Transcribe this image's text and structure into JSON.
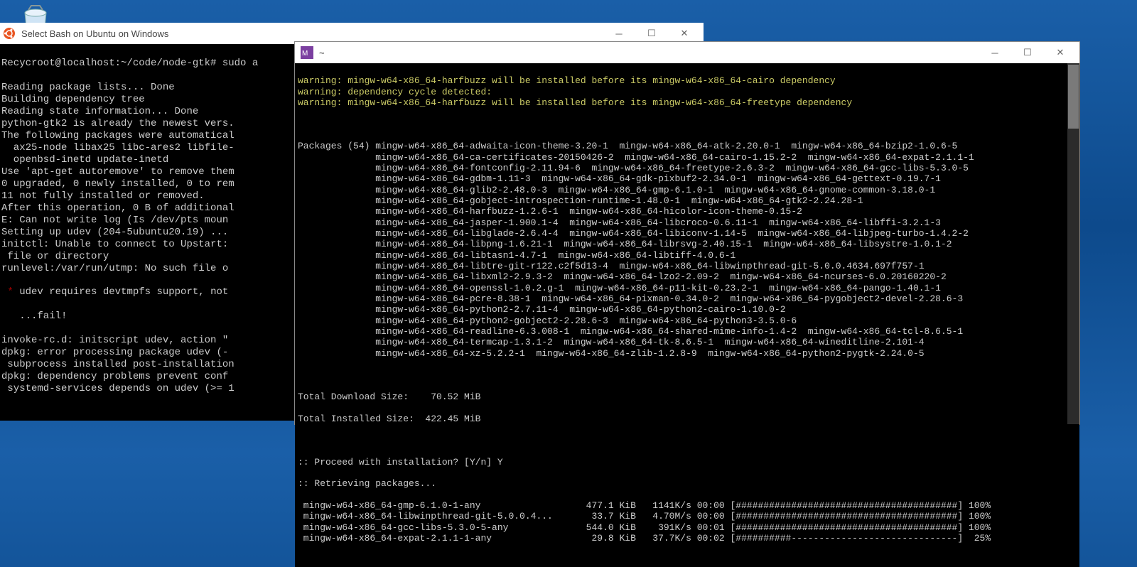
{
  "desktop": {
    "recycle_bin_name": "Recycle Bin"
  },
  "bash_window": {
    "title": "Select Bash on Ubuntu on Windows",
    "prompt_label": "Recycroot@localhost:~/code/node-gtk#",
    "prompt_cmd": " sudo a",
    "lines": [
      "Reading package lists... Done",
      "Building dependency tree",
      "Reading state information... Done",
      "python-gtk2 is already the newest vers.",
      "The following packages were automatical",
      "  ax25-node libax25 libc-ares2 libfile-",
      "  openbsd-inetd update-inetd",
      "Use 'apt-get autoremove' to remove them",
      "0 upgraded, 0 newly installed, 0 to rem",
      "11 not fully installed or removed.",
      "After this operation, 0 B of additional",
      "E: Can not write log (Is /dev/pts moun",
      "Setting up udev (204-5ubuntu20.19) ...",
      "initctl: Unable to connect to Upstart:",
      " file or directory",
      "runlevel:/var/run/utmp: No such file o"
    ],
    "star_line_prefix": " * ",
    "star_line_text": "udev requires devtmpfs support, not ",
    "fail_line": "   ...fail!",
    "lines2": [
      "invoke-rc.d: initscript udev, action \"",
      "dpkg: error processing package udev (-",
      " subprocess installed post-installation",
      "dpkg: dependency problems prevent conf",
      " systemd-services depends on udev (>= 1"
    ]
  },
  "msys_window": {
    "title": "~",
    "warnings": [
      "warning: mingw-w64-x86_64-harfbuzz will be installed before its mingw-w64-x86_64-cairo dependency",
      "warning: dependency cycle detected:",
      "warning: mingw-w64-x86_64-harfbuzz will be installed before its mingw-w64-x86_64-freetype dependency"
    ],
    "packages_header": "Packages (54) ",
    "package_lines": [
      "mingw-w64-x86_64-adwaita-icon-theme-3.20-1  mingw-w64-x86_64-atk-2.20.0-1  mingw-w64-x86_64-bzip2-1.0.6-5",
      "mingw-w64-x86_64-ca-certificates-20150426-2  mingw-w64-x86_64-cairo-1.15.2-2  mingw-w64-x86_64-expat-2.1.1-1",
      "mingw-w64-x86_64-fontconfig-2.11.94-6  mingw-w64-x86_64-freetype-2.6.3-2  mingw-w64-x86_64-gcc-libs-5.3.0-5",
      "mingw-w64-x86_64-gdbm-1.11-3  mingw-w64-x86_64-gdk-pixbuf2-2.34.0-1  mingw-w64-x86_64-gettext-0.19.7-1",
      "mingw-w64-x86_64-glib2-2.48.0-3  mingw-w64-x86_64-gmp-6.1.0-1  mingw-w64-x86_64-gnome-common-3.18.0-1",
      "mingw-w64-x86_64-gobject-introspection-runtime-1.48.0-1  mingw-w64-x86_64-gtk2-2.24.28-1",
      "mingw-w64-x86_64-harfbuzz-1.2.6-1  mingw-w64-x86_64-hicolor-icon-theme-0.15-2",
      "mingw-w64-x86_64-jasper-1.900.1-4  mingw-w64-x86_64-libcroco-0.6.11-1  mingw-w64-x86_64-libffi-3.2.1-3",
      "mingw-w64-x86_64-libglade-2.6.4-4  mingw-w64-x86_64-libiconv-1.14-5  mingw-w64-x86_64-libjpeg-turbo-1.4.2-2",
      "mingw-w64-x86_64-libpng-1.6.21-1  mingw-w64-x86_64-librsvg-2.40.15-1  mingw-w64-x86_64-libsystre-1.0.1-2",
      "mingw-w64-x86_64-libtasn1-4.7-1  mingw-w64-x86_64-libtiff-4.0.6-1",
      "mingw-w64-x86_64-libtre-git-r122.c2f5d13-4  mingw-w64-x86_64-libwinpthread-git-5.0.0.4634.697f757-1",
      "mingw-w64-x86_64-libxml2-2.9.3-2  mingw-w64-x86_64-lzo2-2.09-2  mingw-w64-x86_64-ncurses-6.0.20160220-2",
      "mingw-w64-x86_64-openssl-1.0.2.g-1  mingw-w64-x86_64-p11-kit-0.23.2-1  mingw-w64-x86_64-pango-1.40.1-1",
      "mingw-w64-x86_64-pcre-8.38-1  mingw-w64-x86_64-pixman-0.34.0-2  mingw-w64-x86_64-pygobject2-devel-2.28.6-3",
      "mingw-w64-x86_64-python2-2.7.11-4  mingw-w64-x86_64-python2-cairo-1.10.0-2",
      "mingw-w64-x86_64-python2-gobject2-2.28.6-3  mingw-w64-x86_64-python3-3.5.0-6",
      "mingw-w64-x86_64-readline-6.3.008-1  mingw-w64-x86_64-shared-mime-info-1.4-2  mingw-w64-x86_64-tcl-8.6.5-1",
      "mingw-w64-x86_64-termcap-1.3.1-2  mingw-w64-x86_64-tk-8.6.5-1  mingw-w64-x86_64-wineditline-2.101-4",
      "mingw-w64-x86_64-xz-5.2.2-1  mingw-w64-x86_64-zlib-1.2.8-9  mingw-w64-x86_64-python2-pygtk-2.24.0-5"
    ],
    "total_download_label": "Total Download Size:    70.52 MiB",
    "total_installed_label": "Total Installed Size:  422.45 MiB",
    "proceed_prompt": ":: Proceed with installation? [Y/n] Y",
    "retrieving": ":: Retrieving packages...",
    "downloads": [
      {
        "name": " mingw-w64-x86_64-gmp-6.1.0-1-any",
        "size": "477.1 KiB",
        "speed": "1141K/s",
        "eta": "00:00",
        "bar": "########################################",
        "pct": "100%"
      },
      {
        "name": " mingw-w64-x86_64-libwinpthread-git-5.0.0.4...",
        "size": "33.7 KiB",
        "speed": "4.70M/s",
        "eta": "00:00",
        "bar": "########################################",
        "pct": "100%"
      },
      {
        "name": " mingw-w64-x86_64-gcc-libs-5.3.0-5-any",
        "size": "544.0 KiB",
        "speed": "391K/s",
        "eta": "00:01",
        "bar": "########################################",
        "pct": "100%"
      },
      {
        "name": " mingw-w64-x86_64-expat-2.1.1-1-any",
        "size": "29.8 KiB",
        "speed": "37.7K/s",
        "eta": "00:02",
        "bar": "##########------------------------------",
        "pct": "25%"
      }
    ]
  }
}
